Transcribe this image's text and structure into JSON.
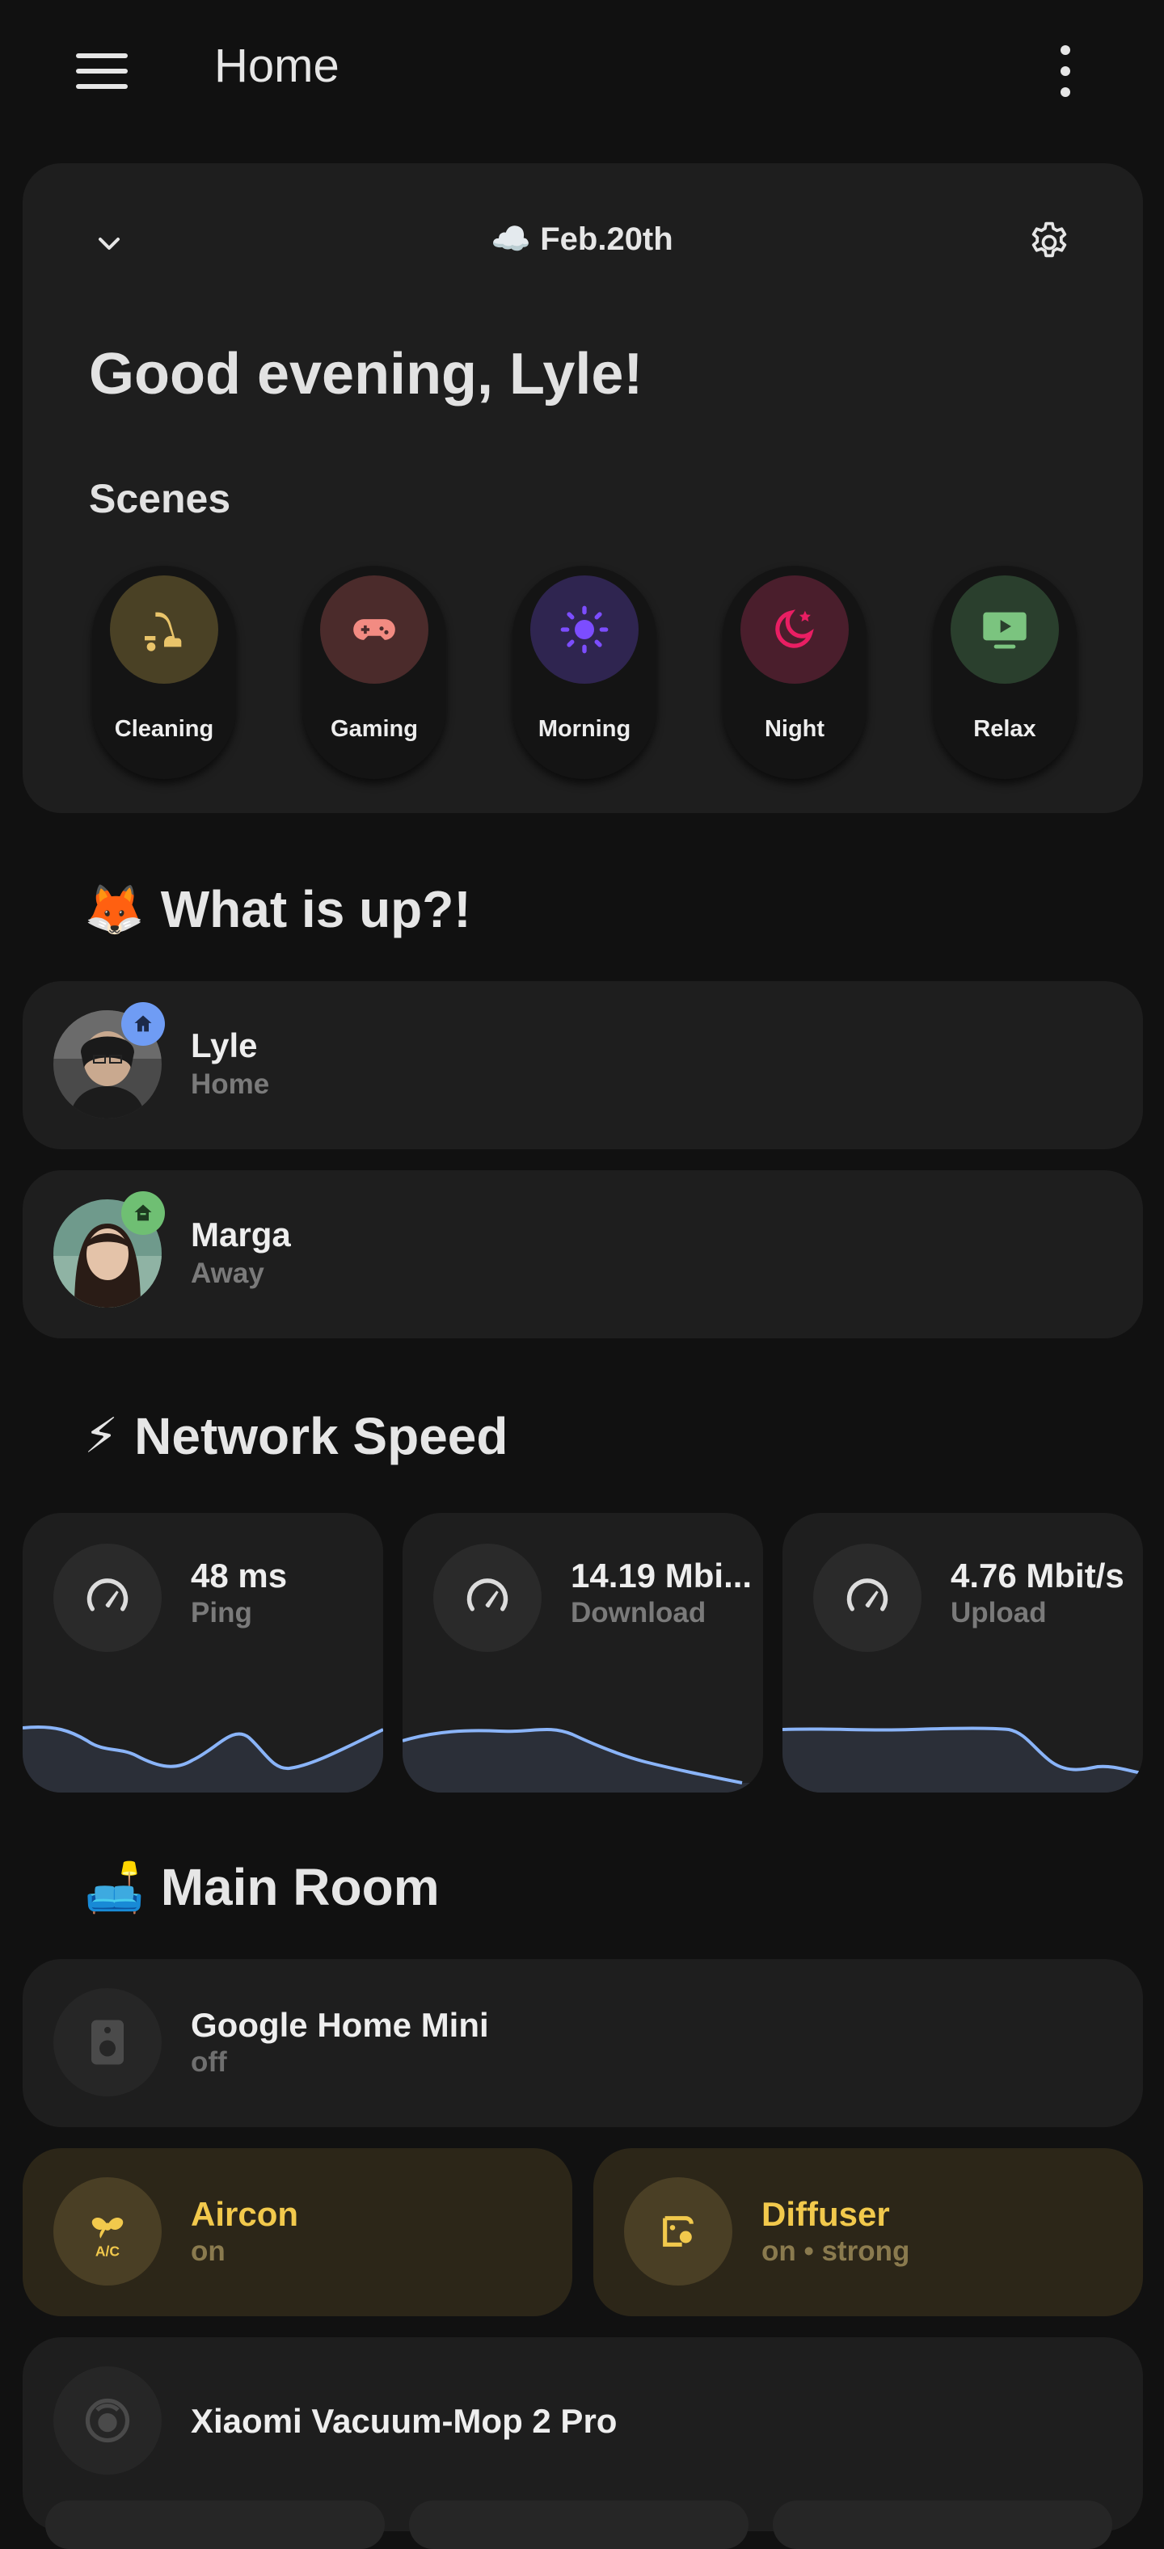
{
  "header": {
    "title": "Home"
  },
  "greeting_card": {
    "weather_icon": "cloud-icon",
    "date": "☁️ Feb.20th",
    "greeting": "Good evening, Lyle!",
    "scenes_title": "Scenes",
    "scenes": [
      {
        "label": "Cleaning",
        "icon": "vacuum-icon",
        "color": "#e9c46a",
        "bg": "#4a4125"
      },
      {
        "label": "Gaming",
        "icon": "gamepad-icon",
        "color": "#f28b82",
        "bg": "#4b2b2b"
      },
      {
        "label": "Morning",
        "icon": "sun-icon",
        "color": "#7c4dff",
        "bg": "#2f2550"
      },
      {
        "label": "Night",
        "icon": "moon-star-icon",
        "color": "#e91e63",
        "bg": "#4a1e2c"
      },
      {
        "label": "Relax",
        "icon": "tv-play-icon",
        "color": "#7bc47f",
        "bg": "#2a3f2d"
      }
    ]
  },
  "whatsup": {
    "emoji": "🦊",
    "title": "What is up?!",
    "people": [
      {
        "name": "Lyle",
        "state": "Home",
        "badge_color": "#6f9cf4",
        "badge_icon": "home-icon"
      },
      {
        "name": "Marga",
        "state": "Away",
        "badge_color": "#6fbf73",
        "badge_icon": "home-away-icon"
      }
    ]
  },
  "network": {
    "emoji": "⚡",
    "title": "Network Speed",
    "cards": [
      {
        "value": "48 ms",
        "label": "Ping",
        "icon": "speedometer-icon"
      },
      {
        "value": "14.19 Mbi...",
        "label": "Download",
        "icon": "speedometer-icon"
      },
      {
        "value": "4.76 Mbit/s",
        "label": "Upload",
        "icon": "speedometer-icon"
      }
    ]
  },
  "main_room": {
    "emoji": "🛋️",
    "title": "Main Room",
    "devices": {
      "google_home": {
        "name": "Google Home Mini",
        "state": "off",
        "icon": "speaker-icon"
      },
      "aircon": {
        "name": "Aircon",
        "state": "on",
        "icon": "air-conditioner-icon"
      },
      "diffuser": {
        "name": "Diffuser",
        "state": "on • strong",
        "icon": "diffuser-icon"
      },
      "vacuum": {
        "name": "Xiaomi Vacuum-Mop 2 Pro",
        "icon": "robot-vacuum-icon"
      }
    }
  },
  "colors": {
    "background": "#111111",
    "card": "#1e1e1e",
    "accent_on": "#f2c94c",
    "graph_line": "#8ab4f8",
    "graph_fill": "#2b2f38"
  }
}
